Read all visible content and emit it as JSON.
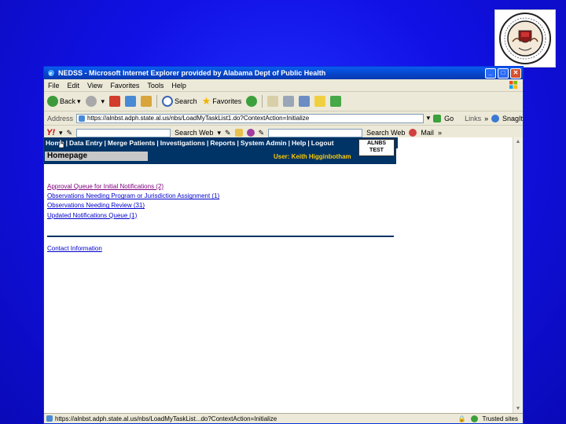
{
  "window": {
    "title": "NEDSS - Microsoft Internet Explorer provided by Alabama Dept of Public Health"
  },
  "menu": [
    "File",
    "Edit",
    "View",
    "Favorites",
    "Tools",
    "Help"
  ],
  "toolbar": {
    "back_label": "Back",
    "search_label": "Search",
    "favorites_label": "Favorites"
  },
  "address": {
    "label": "Address",
    "url": "https://alnbst.adph.state.al.us/nbs/LoadMyTaskList1.do?ContextAction=Initialize",
    "go_label": "Go",
    "links_label": "Links",
    "snagit_label": "SnagIt"
  },
  "yahoo": {
    "logo": "Y!",
    "search_web_label": "Search Web",
    "search_web_label2": "Search Web",
    "mail_label": "Mail"
  },
  "nav": {
    "items": [
      "Home",
      "Data Entry",
      "Merge Patients",
      "Investigations",
      "Reports",
      "System Admin",
      "Help",
      "Logout"
    ],
    "page_title": "Homepage",
    "user": "User: Keith Higginbotham",
    "logo_line1": "ALNBS",
    "logo_line2": "TEST"
  },
  "tasks": [
    "Approval Queue for Initial Notifications (2)",
    "Observations Needing Program or Jurisdiction Assignment (1)",
    "Observations Needing Review (31)",
    "Updated Notifications Queue (1)"
  ],
  "contact_label": "Contact Information",
  "status": {
    "url": "https://alnbst.adph.state.al.us/nbs/LoadMyTaskList...do?ContextAction=Initialize",
    "zone": "Trusted sites"
  },
  "colors": {
    "slide_bg": "#1414e0",
    "nav_bg": "#003366",
    "user_text": "#ffcc00",
    "link": "#0000cc"
  }
}
